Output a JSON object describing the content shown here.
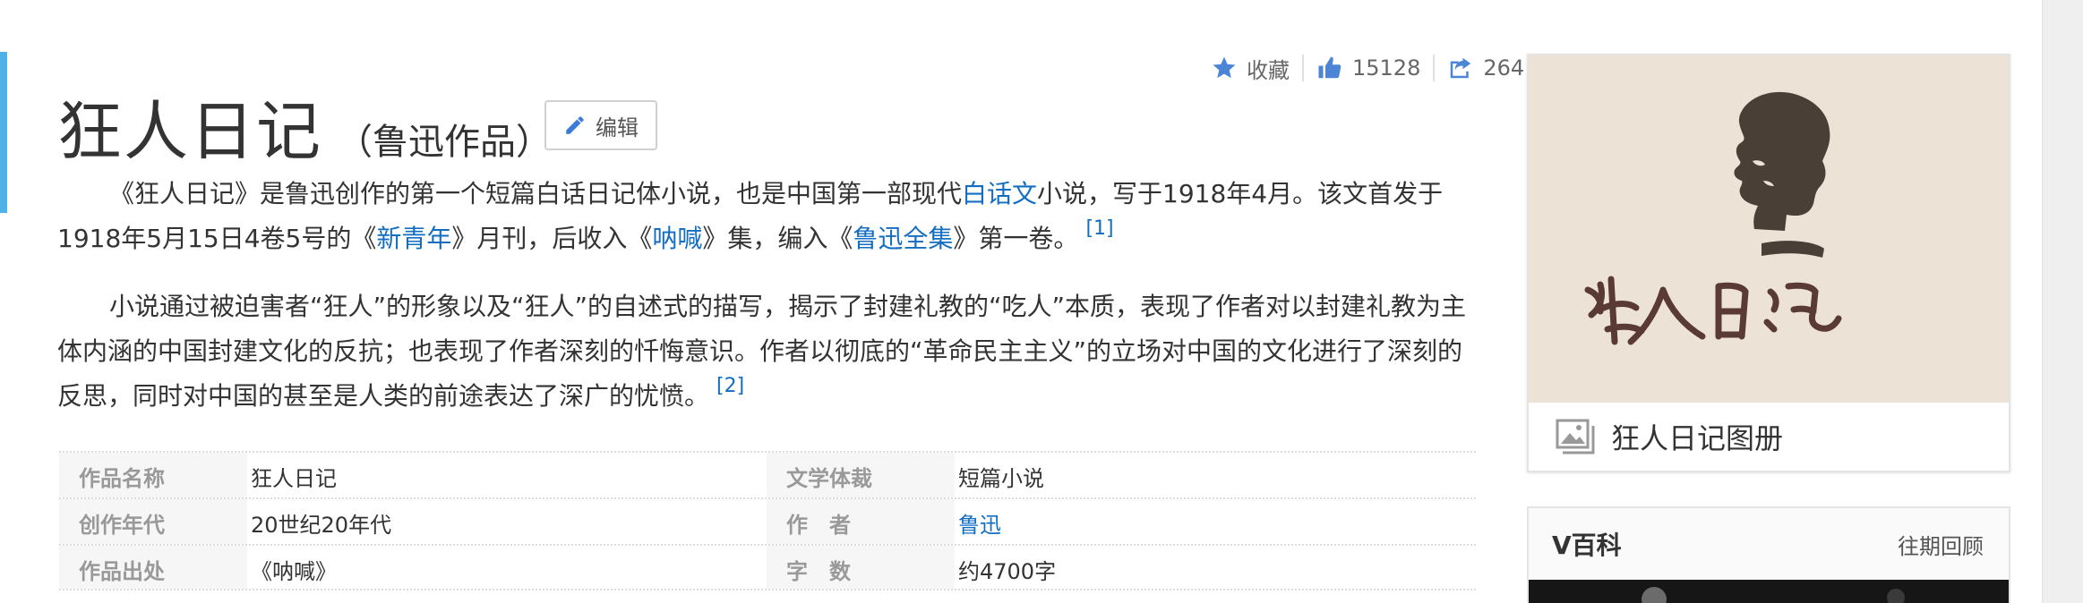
{
  "stats": {
    "favorite_label": "收藏",
    "likes": "15128",
    "shares": "264"
  },
  "title": {
    "main": "狂人日记",
    "sub": "（鲁迅作品）",
    "edit_label": "编辑"
  },
  "para1": {
    "t1": "《狂人日记》是鲁迅创作的第一个短篇白话日记体小说，也是中国第一部现代",
    "l1": "白话文",
    "t2": "小说，写于1918年4月。该文首发于1918年5月15日4卷5号的《",
    "l2": "新青年",
    "t3": "》月刊，后收入《",
    "l3": "呐喊",
    "t4": "》集，编入《",
    "l4": "鲁迅全集",
    "t5": "》第一卷。",
    "ref": "[1]"
  },
  "para2": {
    "text": "小说通过被迫害者“狂人”的形象以及“狂人”的自述式的描写，揭示了封建礼教的“吃人”本质，表现了作者对以封建礼教为主体内涵的中国封建文化的反抗；也表现了作者深刻的忏悔意识。作者以彻底的“革命民主主义”的立场对中国的文化进行了深刻的反思，同时对中国的甚至是人类的前途表达了深广的忧愤。",
    "ref": "[2]"
  },
  "info": [
    {
      "k1": "作品名称",
      "v1": "狂人日记",
      "k2": "文学体裁",
      "v2": "短篇小说"
    },
    {
      "k1": "创作年代",
      "v1": "20世纪20年代",
      "k2": "作　者",
      "v2": "鲁迅"
    },
    {
      "k1": "作品出处",
      "v1": "《呐喊》",
      "k2": "字　数",
      "v2": "约4700字"
    }
  ],
  "album": {
    "caption": "狂人日记图册",
    "image_text": "狂人日记"
  },
  "vbaike": {
    "title": "V百科",
    "more": "往期回顾"
  },
  "colors": {
    "link": "#136ec2",
    "icon_blue": "#4c85d6",
    "accent": "#4fb2e6"
  }
}
